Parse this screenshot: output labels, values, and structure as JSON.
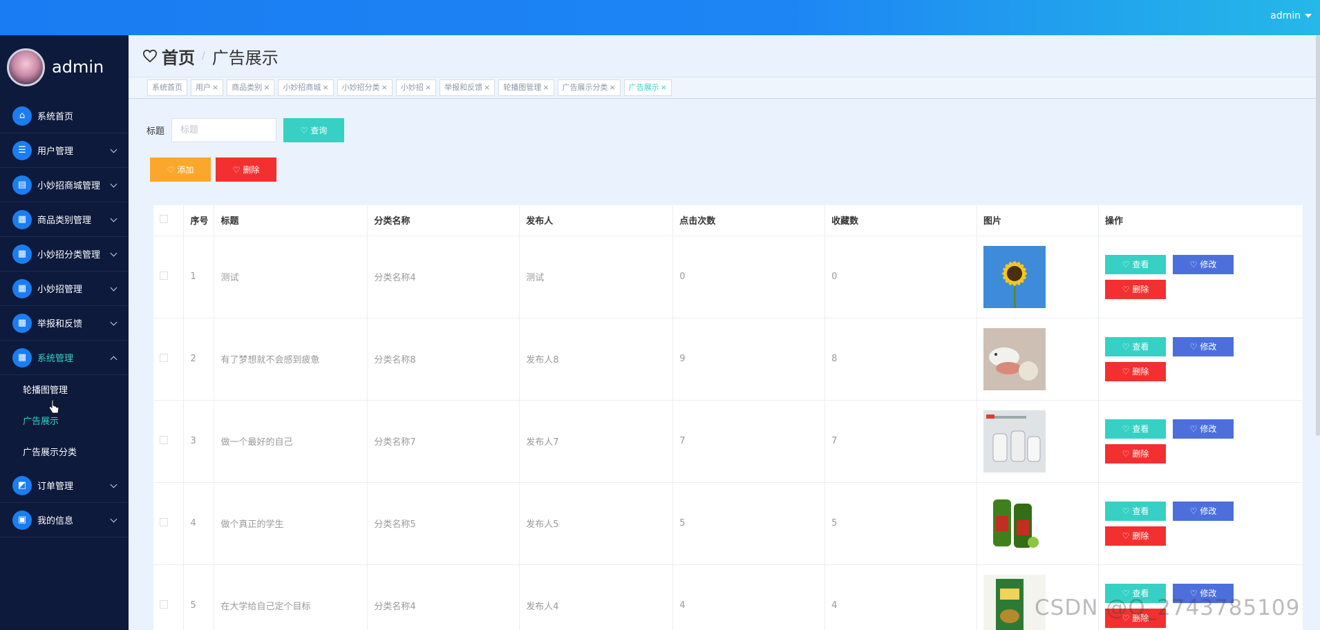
{
  "topbar": {
    "user": "admin"
  },
  "sidebar": {
    "profile_name": "admin",
    "items": [
      {
        "label": "系统首页",
        "icon": "home-icon",
        "glyph": "⌂"
      },
      {
        "label": "用户管理",
        "icon": "list-icon",
        "glyph": "☰"
      },
      {
        "label": "小妙招商城管理",
        "icon": "chart-icon",
        "glyph": "▤"
      },
      {
        "label": "商品类别管理",
        "icon": "grid-icon",
        "glyph": "▦"
      },
      {
        "label": "小妙招分类管理",
        "icon": "grid-icon",
        "glyph": "▦"
      },
      {
        "label": "小妙招管理",
        "icon": "grid-icon",
        "glyph": "▦"
      },
      {
        "label": "举报和反馈",
        "icon": "grid-icon",
        "glyph": "▦"
      },
      {
        "label": "系统管理",
        "icon": "grid-icon",
        "glyph": "▦"
      },
      {
        "label": "订单管理",
        "icon": "cart-icon",
        "glyph": "◩"
      },
      {
        "label": "我的信息",
        "icon": "card-icon",
        "glyph": "▣"
      }
    ],
    "submenu": [
      "轮播图管理",
      "广告展示",
      "广告展示分类"
    ]
  },
  "header": {
    "home": "首页",
    "separator": "/",
    "crumb": "广告展示"
  },
  "tags": [
    "系统首页",
    "用户",
    "商品类别",
    "小妙招商城",
    "小妙招分类",
    "小妙招",
    "举报和反馈",
    "轮播图管理",
    "广告展示分类",
    "广告展示"
  ],
  "search": {
    "label": "标题",
    "placeholder": "标题",
    "button": "查询"
  },
  "actions": {
    "add": "添加",
    "delete": "删除"
  },
  "table": {
    "columns": [
      "序号",
      "标题",
      "分类名称",
      "发布人",
      "点击次数",
      "收藏数",
      "图片",
      "操作"
    ],
    "rows": [
      {
        "no": "1",
        "title": "测试",
        "category": "分类名称4",
        "publisher": "测试",
        "clicks": "0",
        "favorites": "0",
        "image": "sunflower"
      },
      {
        "no": "2",
        "title": "有了梦想就不会感到疲惫",
        "category": "分类名称8",
        "publisher": "发布人8",
        "clicks": "9",
        "favorites": "8",
        "image": "bird-toy"
      },
      {
        "no": "3",
        "title": "做一个最好的自己",
        "category": "分类名称7",
        "publisher": "发布人7",
        "clicks": "7",
        "favorites": "7",
        "image": "bottles"
      },
      {
        "no": "4",
        "title": "做个真正的学生",
        "category": "分类名称5",
        "publisher": "发布人5",
        "clicks": "5",
        "favorites": "5",
        "image": "oil"
      },
      {
        "no": "5",
        "title": "在大学给自己定个目标",
        "category": "分类名称4",
        "publisher": "发布人4",
        "clicks": "4",
        "favorites": "4",
        "image": "box"
      }
    ],
    "ops": {
      "view": "查看",
      "edit": "修改",
      "delete": "删除"
    }
  },
  "watermark": "CSDN @Q_2743785109"
}
